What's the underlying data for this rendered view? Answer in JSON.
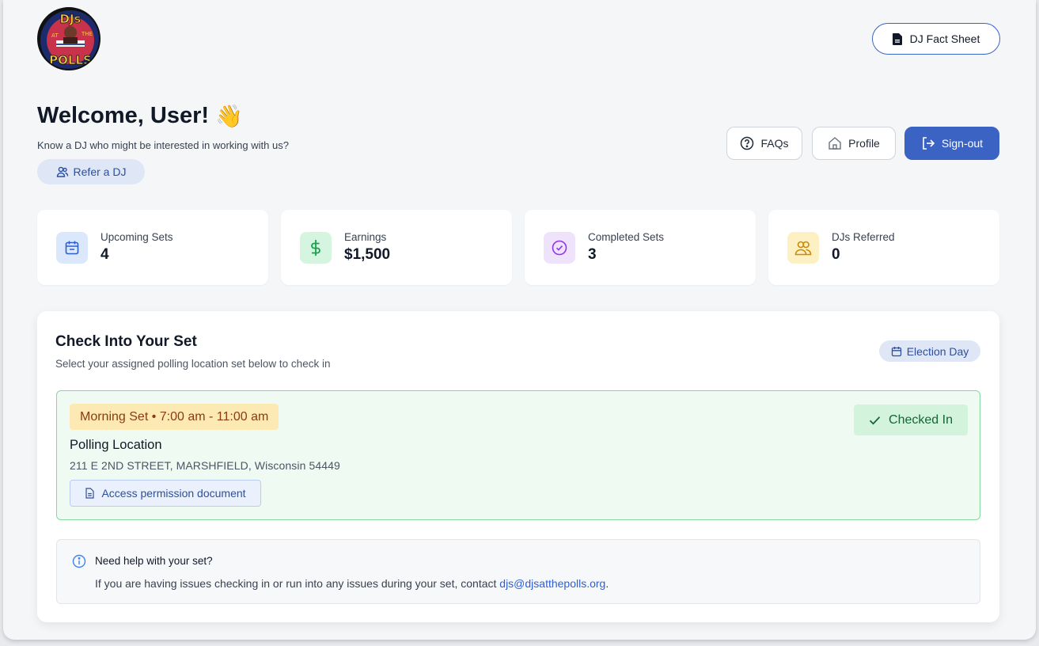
{
  "header": {
    "logo_text_top": "DJs",
    "logo_text_bottom": "POLLS",
    "logo_text_at": "AT",
    "logo_text_the": "THE",
    "fact_sheet_label": "DJ Fact Sheet"
  },
  "welcome": {
    "title": "Welcome, User!",
    "emoji": "👋",
    "subtitle": "Know a DJ who might be interested in working with us?",
    "refer_label": "Refer a DJ"
  },
  "nav": {
    "faqs_label": "FAQs",
    "profile_label": "Profile",
    "signout_label": "Sign-out"
  },
  "stats": [
    {
      "label": "Upcoming Sets",
      "value": "4",
      "icon": "calendar-icon",
      "bg": "#dbe8fb",
      "color": "#2d5fd1"
    },
    {
      "label": "Earnings",
      "value": "$1,500",
      "icon": "dollar-icon",
      "bg": "#d6f5e0",
      "color": "#16a34a"
    },
    {
      "label": "Completed Sets",
      "value": "3",
      "icon": "check-circle-icon",
      "bg": "#efe3fb",
      "color": "#9333ea"
    },
    {
      "label": "DJs Referred",
      "value": "0",
      "icon": "users-icon",
      "bg": "#fdf1c4",
      "color": "#ca8a04"
    }
  ],
  "checkin": {
    "title": "Check Into Your Set",
    "subtitle": "Select your assigned polling location set below to check in",
    "badge_label": "Election Day",
    "set": {
      "time_label": "Morning Set • 7:00 am - 11:00 am",
      "location_title": "Polling Location",
      "address": "211 E 2ND STREET, MARSHFIELD, Wisconsin 54449",
      "doc_label": "Access permission document",
      "status_label": "Checked In"
    },
    "help": {
      "title": "Need help with your set?",
      "text": "If you are having issues checking in or run into any issues during your set, contact",
      "email": "djs@djsatthepolls.org",
      "suffix": "."
    }
  },
  "colors": {
    "accent": "#3b63c4",
    "success_bg": "#effbf2",
    "success_border": "#86d9a0"
  }
}
